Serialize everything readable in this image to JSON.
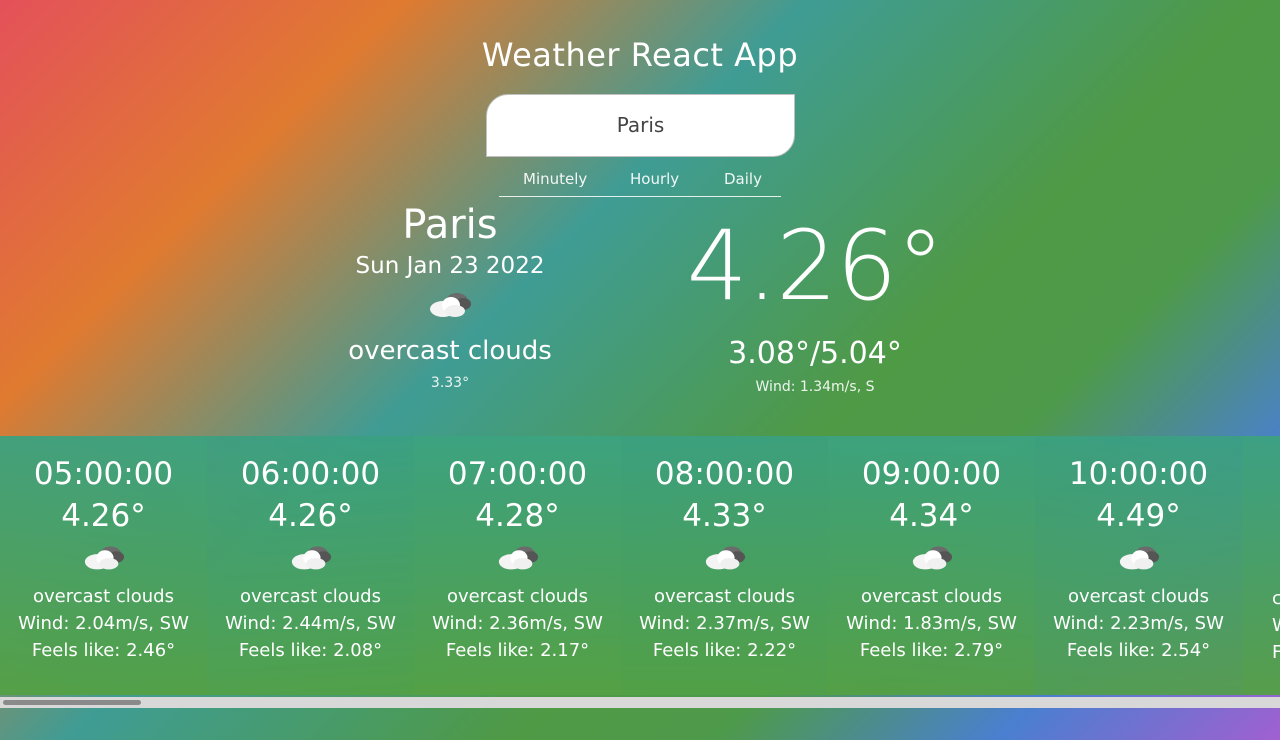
{
  "app": {
    "title": "Weather React App"
  },
  "search": {
    "value": "Paris"
  },
  "tabs": [
    {
      "label": "Minutely"
    },
    {
      "label": "Hourly"
    },
    {
      "label": "Daily"
    }
  ],
  "current": {
    "city": "Paris",
    "date": "Sun Jan 23 2022",
    "icon": "overcast-clouds-icon",
    "description": "overcast clouds",
    "sub_temp": "3.33°",
    "temperature": "4.26°",
    "range": "3.08°/5.04°",
    "wind": "Wind: 1.34m/s, S"
  },
  "hourly": [
    {
      "time": "05:00:00",
      "temp": "4.26°",
      "desc": "overcast clouds",
      "wind": "Wind: 2.04m/s, SW",
      "feels": "Feels like: 2.46°"
    },
    {
      "time": "06:00:00",
      "temp": "4.26°",
      "desc": "overcast clouds",
      "wind": "Wind: 2.44m/s, SW",
      "feels": "Feels like: 2.08°"
    },
    {
      "time": "07:00:00",
      "temp": "4.28°",
      "desc": "overcast clouds",
      "wind": "Wind: 2.36m/s, SW",
      "feels": "Feels like: 2.17°"
    },
    {
      "time": "08:00:00",
      "temp": "4.33°",
      "desc": "overcast clouds",
      "wind": "Wind: 2.37m/s, SW",
      "feels": "Feels like: 2.22°"
    },
    {
      "time": "09:00:00",
      "temp": "4.34°",
      "desc": "overcast clouds",
      "wind": "Wind: 1.83m/s, SW",
      "feels": "Feels like: 2.79°"
    },
    {
      "time": "10:00:00",
      "temp": "4.49°",
      "desc": "overcast clouds",
      "wind": "Wind: 2.23m/s, SW",
      "feels": "Feels like: 2.54°"
    },
    {
      "time": "",
      "temp": "",
      "desc": "c",
      "wind": "W",
      "feels": "F"
    }
  ]
}
